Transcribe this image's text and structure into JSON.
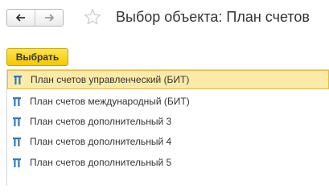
{
  "header": {
    "title": "Выбор объекта: План счетов",
    "back_icon": "arrow-left-icon",
    "forward_icon": "arrow-right-icon",
    "favorite_icon": "star-outline-icon"
  },
  "toolbar": {
    "select_label": "Выбрать"
  },
  "list": {
    "items": [
      {
        "label": "План счетов управленческий (БИТ)",
        "icon": "type-t-icon",
        "selected": true
      },
      {
        "label": "План счетов международный (БИТ)",
        "icon": "type-t-icon",
        "selected": false
      },
      {
        "label": "План счетов дополнительный 3",
        "icon": "type-t-icon",
        "selected": false
      },
      {
        "label": "План счетов дополнительный 4",
        "icon": "type-t-icon",
        "selected": false
      },
      {
        "label": "План счетов дополнительный 5",
        "icon": "type-t-icon",
        "selected": false
      }
    ]
  },
  "colors": {
    "accent_button": "#f5c900",
    "selection_fill": "#fbeaa8",
    "selection_border": "#e7b84b",
    "type_icon": "#2f7ac0"
  }
}
